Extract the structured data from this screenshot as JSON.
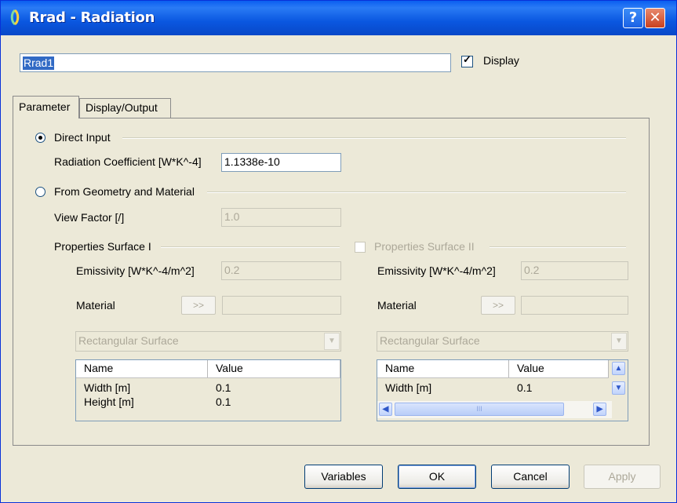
{
  "window": {
    "title": "Rrad - Radiation",
    "help_button": "?",
    "close_button": "✕"
  },
  "name_field": {
    "value": "Rrad1"
  },
  "display_checkbox": {
    "label": "Display",
    "checked": true
  },
  "tabs": [
    {
      "label": "Parameter",
      "active": true
    },
    {
      "label": "Display/Output",
      "active": false
    }
  ],
  "direct_input": {
    "label": "Direct Input",
    "selected": true,
    "coeff_label": "Radiation Coefficient [W*K^-4]",
    "coeff_value": "1.1338e-10"
  },
  "from_geometry": {
    "label": "From Geometry and Material",
    "selected": false,
    "view_factor_label": "View Factor [/]",
    "view_factor_value": "1.0"
  },
  "surface1": {
    "title": "Properties Surface I",
    "emissivity_label": "Emissivity [W*K^-4/m^2]",
    "emissivity_value": "0.2",
    "material_label": "Material",
    "material_button": ">>",
    "material_value": "",
    "shape": "Rectangular Surface",
    "table": {
      "columns": [
        "Name",
        "Value"
      ],
      "rows": [
        {
          "name": "Width [m]",
          "value": "0.1"
        },
        {
          "name": "Height [m]",
          "value": "0.1"
        }
      ]
    }
  },
  "surface2": {
    "title": "Properties Surface II",
    "checked": false,
    "emissivity_label": "Emissivity [W*K^-4/m^2]",
    "emissivity_value": "0.2",
    "material_label": "Material",
    "material_button": ">>",
    "material_value": "",
    "shape": "Rectangular Surface",
    "table": {
      "columns": [
        "Name",
        "Value"
      ],
      "rows": [
        {
          "name": "Width [m]",
          "value": "0.1"
        }
      ]
    },
    "hscroll_grip": "III"
  },
  "buttons": {
    "variables": "Variables",
    "ok": "OK",
    "cancel": "Cancel",
    "apply": "Apply"
  },
  "colors": {
    "titlebar": "#0a57e0",
    "dialog_bg": "#ece9d8",
    "selection": "#316ac5",
    "disabled_text": "#aca899"
  }
}
